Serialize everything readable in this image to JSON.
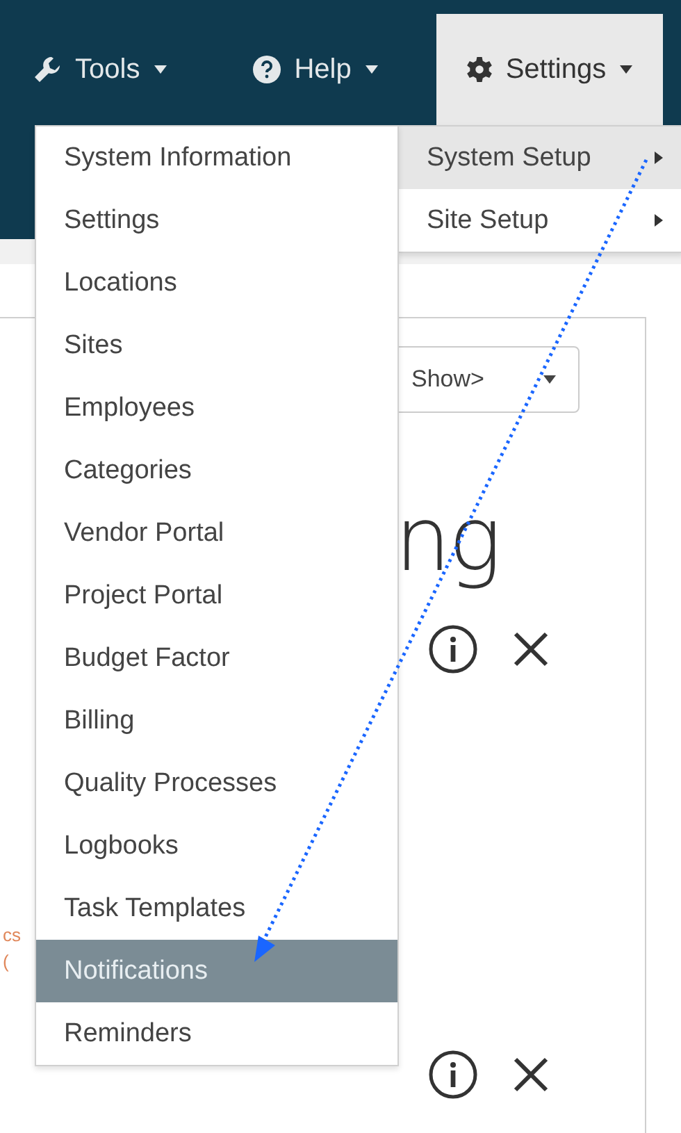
{
  "navbar": {
    "items": [
      {
        "kind": "tools",
        "label": "Tools",
        "selected": false
      },
      {
        "kind": "help",
        "label": "Help",
        "selected": false
      },
      {
        "kind": "settings",
        "label": "Settings",
        "selected": true
      }
    ]
  },
  "settings_menu": {
    "items": [
      {
        "label": "System Setup",
        "selected": true
      },
      {
        "label": "Site Setup",
        "selected": false
      }
    ]
  },
  "system_setup_menu": {
    "items": [
      {
        "label": "System Information",
        "selected": false
      },
      {
        "label": "Settings",
        "selected": false
      },
      {
        "label": "Locations",
        "selected": false
      },
      {
        "label": "Sites",
        "selected": false
      },
      {
        "label": "Employees",
        "selected": false
      },
      {
        "label": "Categories",
        "selected": false
      },
      {
        "label": "Vendor Portal",
        "selected": false
      },
      {
        "label": "Project Portal",
        "selected": false
      },
      {
        "label": "Budget Factor",
        "selected": false
      },
      {
        "label": "Billing",
        "selected": false
      },
      {
        "label": "Quality Processes",
        "selected": false
      },
      {
        "label": "Logbooks",
        "selected": false
      },
      {
        "label": "Task Templates",
        "selected": false
      },
      {
        "label": "Notifications",
        "selected": true
      },
      {
        "label": "Reminders",
        "selected": false
      }
    ]
  },
  "page": {
    "select": {
      "value": "Show>"
    },
    "heading_right": "ng",
    "side_fragments": [
      "cs",
      "("
    ]
  }
}
